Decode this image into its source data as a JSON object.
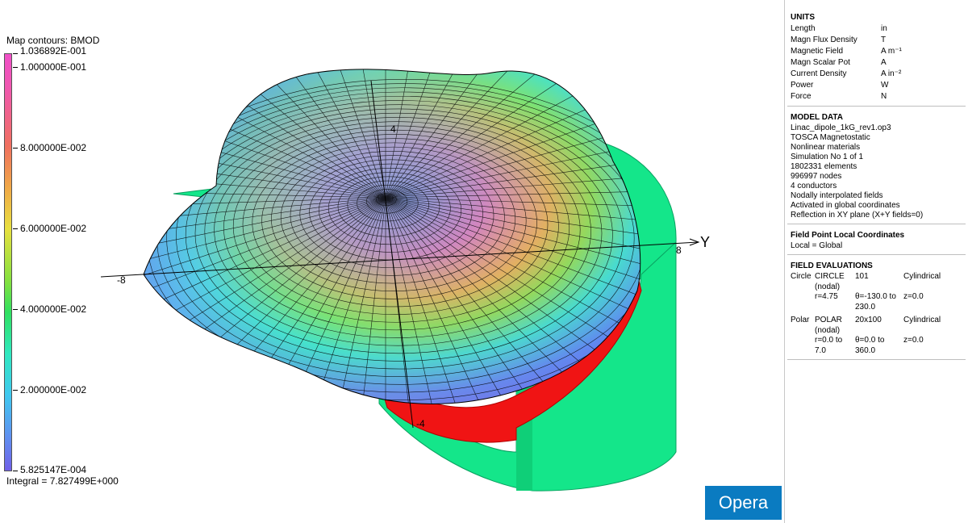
{
  "legend": {
    "title": "Map contours: BMOD",
    "max_label": "1.036892E-001",
    "ticks": [
      "1.000000E-001",
      "8.000000E-002",
      "6.000000E-002",
      "4.000000E-002",
      "2.000000E-002"
    ],
    "min_label": "5.825147E-004",
    "integral": "Integral = 7.827499E+000"
  },
  "axes": {
    "y_name": "Y",
    "y_pos_tick": "8",
    "y_neg_tick": "-8",
    "z_top_tick": "4",
    "z_bottom_tick": "-4"
  },
  "panel": {
    "units": {
      "title": "UNITS",
      "rows": [
        {
          "k": "Length",
          "v": "in"
        },
        {
          "k": "Magn Flux Density",
          "v": "T"
        },
        {
          "k": "Magnetic Field",
          "v": "A m⁻¹"
        },
        {
          "k": "Magn Scalar Pot",
          "v": "A"
        },
        {
          "k": "Current Density",
          "v": "A in⁻²"
        },
        {
          "k": "Power",
          "v": "W"
        },
        {
          "k": "Force",
          "v": "N"
        }
      ]
    },
    "model": {
      "title": "MODEL DATA",
      "lines": [
        "Linac_dipole_1kG_rev1.op3",
        "TOSCA Magnetostatic",
        "Nonlinear materials",
        "Simulation No 1 of 1",
        "1802331 elements",
        "996997 nodes",
        "4 conductors",
        "Nodally interpolated fields",
        "Activated in global coordinates",
        "Reflection in XY plane (X+Y fields=0)"
      ]
    },
    "fieldpoint": {
      "title": "Field Point Local Coordinates",
      "line": "Local = Global"
    },
    "evals": {
      "title": "FIELD EVALUATIONS",
      "circle": {
        "kind": "Circle",
        "name": "CIRCLE",
        "nodal": "(nodal)",
        "count": "101",
        "coord": "Cylindrical",
        "r": "r=4.75",
        "theta": "θ=-130.0 to 230.0",
        "z": "z=0.0"
      },
      "polar": {
        "kind": "Polar",
        "name": "POLAR",
        "nodal": "(nodal)",
        "count": "20x100",
        "coord": "Cylindrical",
        "r": "r=0.0 to 7.0",
        "theta": "θ=0.0 to 360.0",
        "z": "z=0.0"
      }
    }
  },
  "logo": "Opera",
  "colors": {
    "magnet_green": "#14e68a",
    "coil_red": "#f01414",
    "panel_border": "#bfbfbf",
    "logo_blue": "#0a7bc1"
  }
}
